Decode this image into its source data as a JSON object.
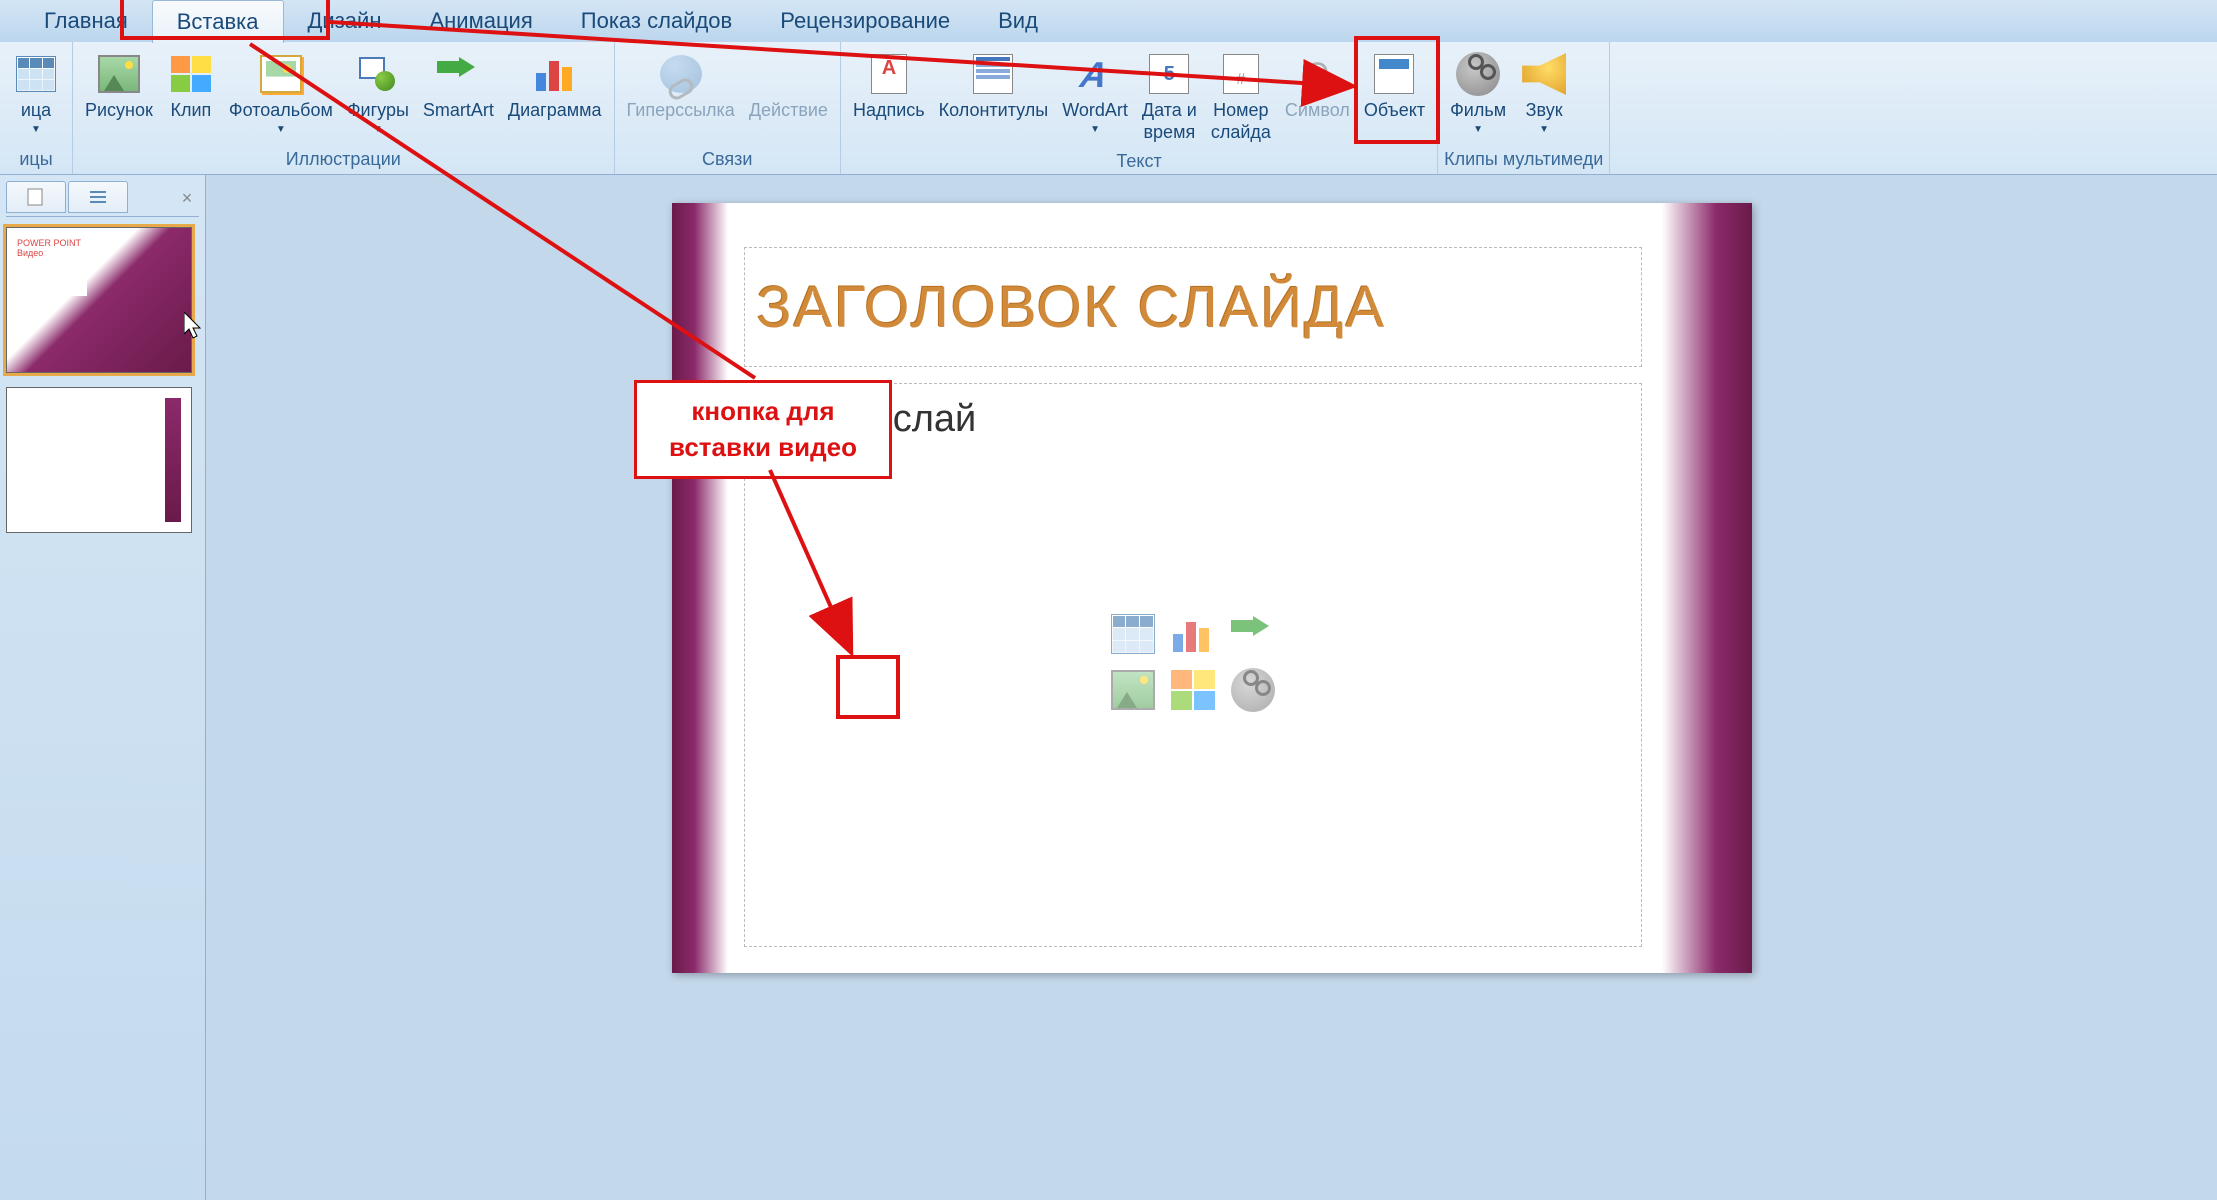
{
  "menu": {
    "tabs": [
      "Главная",
      "Вставка",
      "Дизайн",
      "Анимация",
      "Показ слайдов",
      "Рецензирование",
      "Вид"
    ],
    "active_index": 1
  },
  "ribbon": {
    "groups": [
      {
        "label": "ицы",
        "buttons": [
          {
            "label": "ица",
            "icon": "table"
          }
        ]
      },
      {
        "label": "Иллюстрации",
        "buttons": [
          {
            "label": "Рисунок",
            "icon": "picture"
          },
          {
            "label": "Клип",
            "icon": "clip"
          },
          {
            "label": "Фотоальбом",
            "icon": "album",
            "dropdown": true
          },
          {
            "label": "Фигуры",
            "icon": "shapes",
            "dropdown": true
          },
          {
            "label": "SmartArt",
            "icon": "smartart"
          },
          {
            "label": "Диаграмма",
            "icon": "chart"
          }
        ]
      },
      {
        "label": "Связи",
        "buttons": [
          {
            "label": "Гиперссылка",
            "icon": "link",
            "disabled": true
          },
          {
            "label": "Действие",
            "icon": "action",
            "disabled": true
          }
        ]
      },
      {
        "label": "Текст",
        "buttons": [
          {
            "label": "Надпись",
            "icon": "textbox"
          },
          {
            "label": "Колонтитулы",
            "icon": "header"
          },
          {
            "label": "WordArt",
            "icon": "wordart",
            "dropdown": true
          },
          {
            "label": "Дата и\nвремя",
            "icon": "datetime"
          },
          {
            "label": "Номер\nслайда",
            "icon": "slidenum"
          },
          {
            "label": "Символ",
            "icon": "symbol",
            "disabled": true
          },
          {
            "label": "Объект",
            "icon": "object"
          }
        ]
      },
      {
        "label": "Клипы мультимеди",
        "buttons": [
          {
            "label": "Фильм",
            "icon": "film",
            "dropdown": true
          },
          {
            "label": "Звук",
            "icon": "sound",
            "dropdown": true
          }
        ]
      }
    ]
  },
  "slide_panel": {
    "close": "×",
    "thumb1_text": "POWER POINT\nВидео"
  },
  "slide": {
    "title": "ЗАГОЛОВОК СЛАЙДА",
    "body": "Текст слай",
    "content_icons": [
      "table",
      "chart",
      "smartart",
      "picture",
      "clip",
      "film"
    ]
  },
  "annotation": {
    "label": "кнопка для\nвставки видео"
  },
  "icons": {
    "datetime_text": "5",
    "slidenum_text": "#",
    "symbol_text": "Ω"
  }
}
